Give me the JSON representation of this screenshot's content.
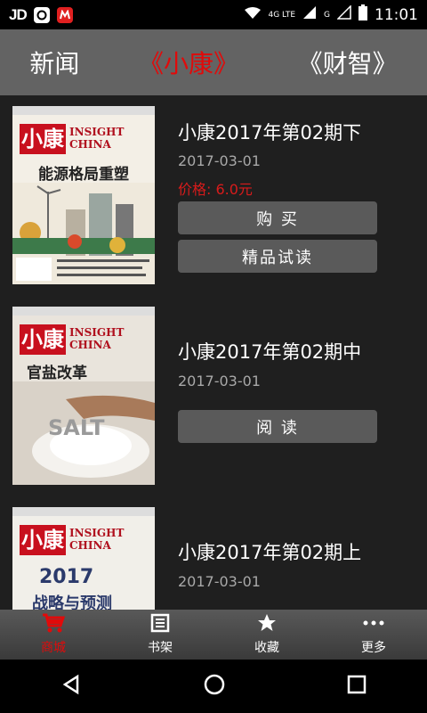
{
  "status_bar": {
    "left_text": "JD",
    "network_label": "4G LTE",
    "signal_label": "G",
    "time": "11:01"
  },
  "tabs": [
    {
      "label": "新闻",
      "active": false
    },
    {
      "label": "《小康》",
      "active": true
    },
    {
      "label": "《财智》",
      "active": false
    }
  ],
  "items": [
    {
      "title": "小康2017年第02期下",
      "date": "2017-03-01",
      "price": "价格:  6.0元",
      "cover_logo": "小康",
      "cover_en": "INSIGHT CHINA",
      "cover_title": "能源格局重塑",
      "buttons": [
        "购 买",
        "精品试读"
      ]
    },
    {
      "title": "小康2017年第02期中",
      "date": "2017-03-01",
      "cover_logo": "小康",
      "cover_en": "INSIGHT CHINA",
      "cover_title": "官盐改革",
      "cover_sub": "SALT",
      "buttons": [
        "阅 读"
      ]
    },
    {
      "title": "小康2017年第02期上",
      "date": "2017-03-01",
      "cover_logo": "小康",
      "cover_en": "INSIGHT CHINA",
      "cover_title": "2017",
      "cover_sub": "战略与预测"
    }
  ],
  "bottom_nav": [
    {
      "label": "商城",
      "icon": "cart-icon",
      "active": true
    },
    {
      "label": "书架",
      "icon": "bookshelf-icon",
      "active": false
    },
    {
      "label": "收藏",
      "icon": "star-icon",
      "active": false
    },
    {
      "label": "更多",
      "icon": "more-icon",
      "active": false
    }
  ],
  "colors": {
    "accent": "#e10a0a",
    "price": "#d81b1b"
  }
}
